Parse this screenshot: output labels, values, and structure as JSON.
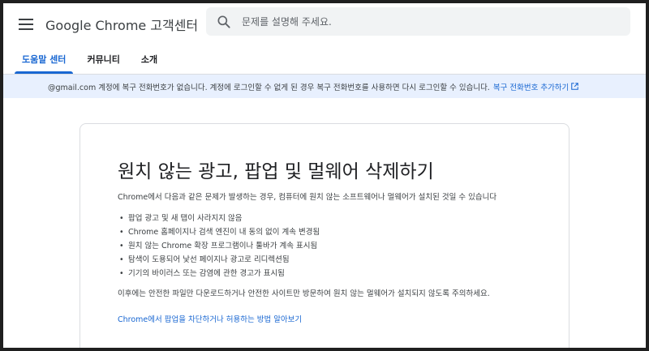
{
  "header": {
    "brand_name": "Google Chrome",
    "brand_suffix": "고객센터",
    "search_placeholder": "문제를 설명해 주세요."
  },
  "tabs": [
    {
      "label": "도움말 센터",
      "active": true
    },
    {
      "label": "커뮤니티",
      "active": false
    },
    {
      "label": "소개",
      "active": false
    }
  ],
  "banner": {
    "message": "@gmail.com 계정에 복구 전화번호가 없습니다. 계정에 로그인할 수 없게 된 경우 복구 전화번호를 사용하면 다시 로그인할 수 있습니다.",
    "link_label": "복구 전화번호 추가하기"
  },
  "article": {
    "title": "원치 않는 광고, 팝업 및 멀웨어 삭제하기",
    "intro": "Chrome에서 다음과 같은 문제가 발생하는 경우, 컴퓨터에 원치 않는 소프트웨어나 멀웨어가 설치된 것일 수 있습니다",
    "bullets": [
      "팝업 광고 및 새 탭이 사라지지 않음",
      "Chrome 홈페이지나 검색 엔진이 내 동의 없이 계속 변경됨",
      "원치 않는 Chrome 확장 프로그램이나 툴바가 계속 표시됨",
      "탐색이 도용되어 낯선 페이지나 광고로 리디렉션됨",
      "기기의 바이러스 또는 감염에 관한 경고가 표시됨"
    ],
    "outro": "이후에는 안전한 파일만 다운로드하거나 안전한 사이트만 방문하여 원치 않는 멀웨어가 설치되지 않도록 주의하세요.",
    "help_link": "Chrome에서 팝업을 차단하거나 허용하는 방법 알아보기"
  },
  "colors": {
    "accent": "#1967d2",
    "banner_bg": "#e8f0fe",
    "search_bg": "#f1f3f4"
  },
  "icons": [
    "menu-icon",
    "search-icon",
    "external-link-icon"
  ]
}
